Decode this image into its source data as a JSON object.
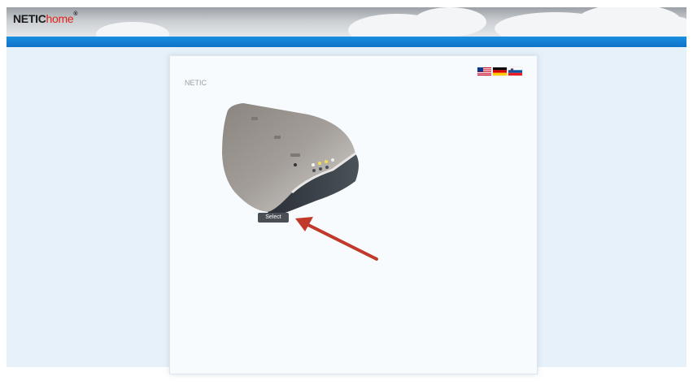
{
  "header": {
    "logo_part1": "NETIC",
    "logo_part2": "home",
    "logo_mark": "®"
  },
  "panel": {
    "title": "NETIC",
    "languages": [
      "english-flag-icon",
      "german-flag-icon",
      "slovenian-flag-icon"
    ],
    "select_label": "Select"
  },
  "colors": {
    "bluebar": "#0f72c8",
    "background": "#e6f1f9",
    "logo_accent": "#e2231a",
    "arrow": "#c0392b"
  }
}
